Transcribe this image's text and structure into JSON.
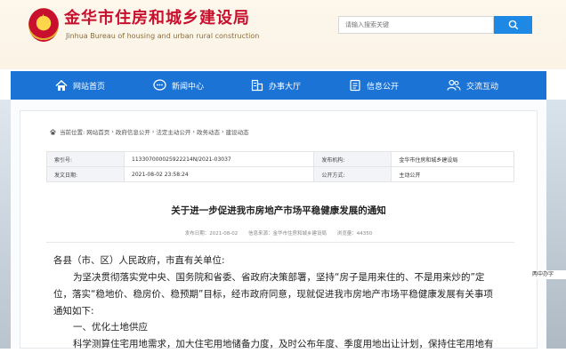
{
  "header": {
    "title": "金华市住房和城乡建设局",
    "subtitle": "Jinhua Bureau of housing and urban rural construction",
    "search_placeholder": "请输入搜索关键"
  },
  "nav": {
    "items": [
      {
        "label": "网站首页",
        "icon": "home-icon"
      },
      {
        "label": "新闻中心",
        "icon": "chat-icon"
      },
      {
        "label": "办事大厅",
        "icon": "building-icon"
      },
      {
        "label": "信息公开",
        "icon": "document-icon"
      },
      {
        "label": "交流互动",
        "icon": "users-icon"
      }
    ]
  },
  "breadcrumb": {
    "prefix": "当前位置:",
    "items": [
      "网站首页",
      "政府信息公开",
      "法定主动公开",
      "政务动态",
      "建设动态"
    ],
    "separator": "›"
  },
  "meta": {
    "index_label": "索引号:",
    "index_value": "113307000025922214N/2021-03037",
    "org_label": "发布机构:",
    "org_value": "金华市住房和城乡建设局",
    "date_label": "发文日期:",
    "date_value": "2021-08-02 23:58:24",
    "public_label": "公开方式:",
    "public_value": "主动公开"
  },
  "article": {
    "title": "关于进一步促进我市房地产市场平稳健康发展的通知",
    "published": "发布日期：2021-08-02",
    "source": "信息来源：金华市住房和城乡建设局",
    "views": "浏览量：44350",
    "salutation": "各县（市、区）人民政府，市直有关单位:",
    "para1_line1": "为坚决贯彻落实党中央、国务院和省委、省政府决策部署，坚持“房子是用来住的、不是用来炒的”定",
    "para1_line2": "位，落实“稳地价、稳房价、稳预期”目标，经市政府同意，现就促进我市房地产市场平稳健康发展有关事项",
    "para1_line3": "通知如下:",
    "section1": "一、优化土地供应",
    "para2_line1": "科学测算住宅用地需求，加大住宅用地储备力度，及时公布年度、季度用地出让计划，保持住宅用地有"
  },
  "side_tag": "两中办字",
  "colors": {
    "brand": "#c8102e",
    "nav": "#1b73d6"
  }
}
